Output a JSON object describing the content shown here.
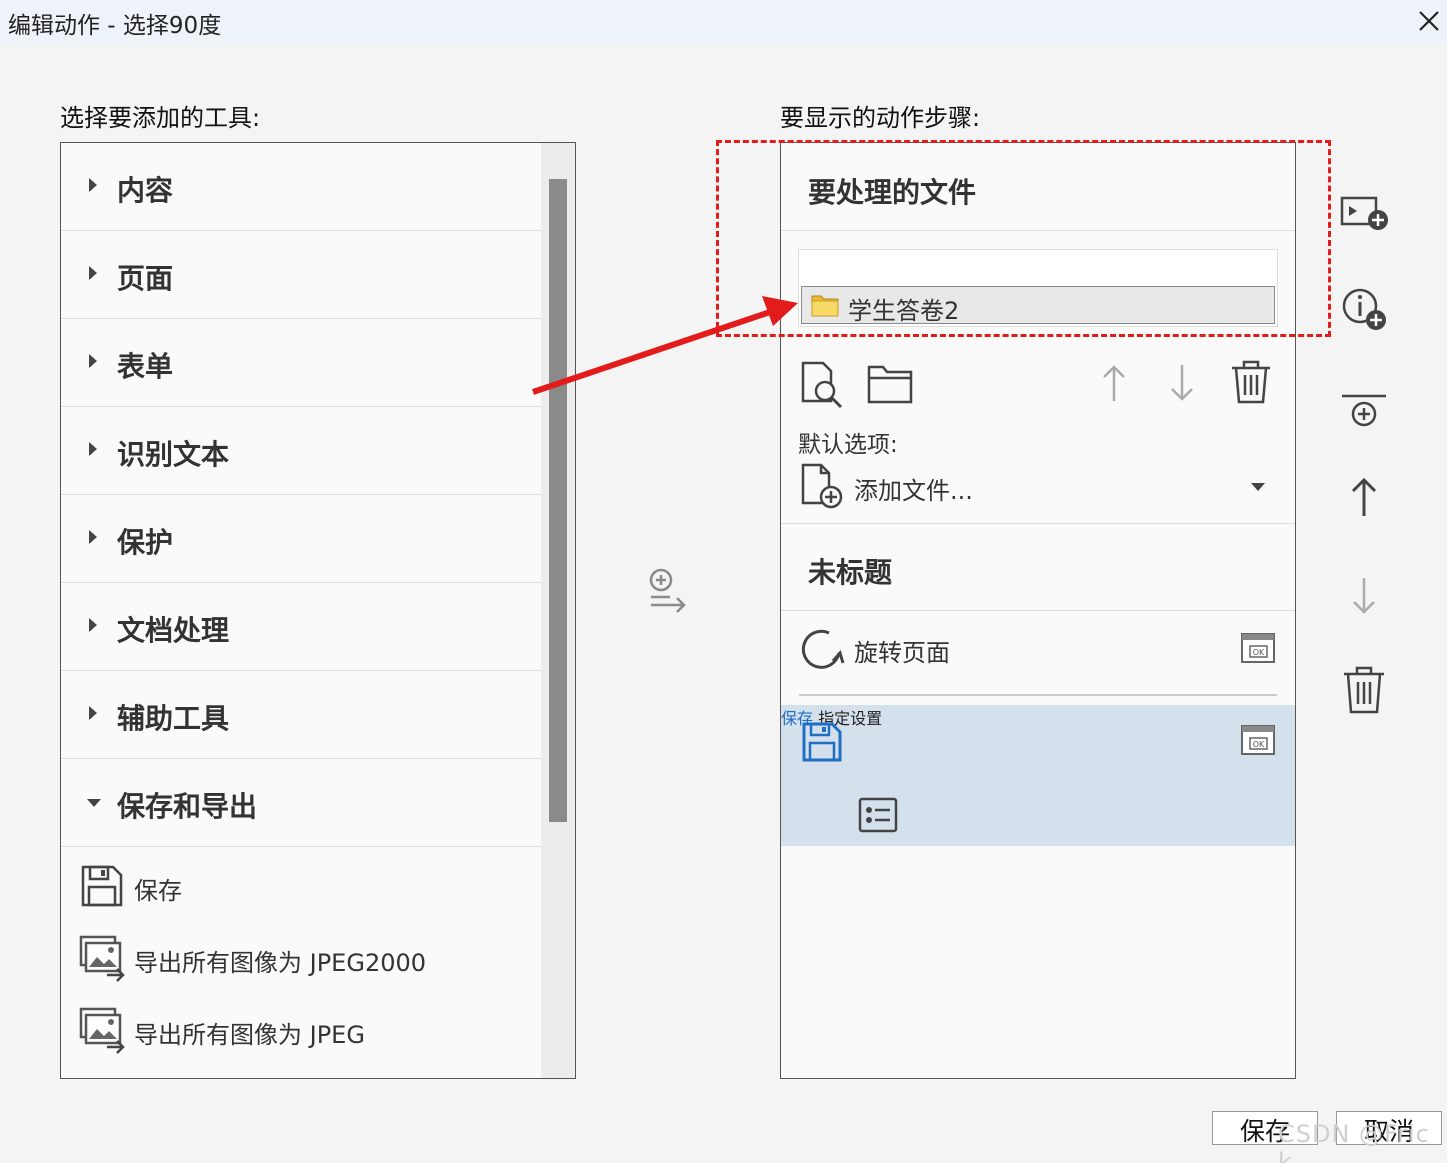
{
  "window": {
    "title": "编辑动作 - 选择90度"
  },
  "left": {
    "heading": "选择要添加的工具:",
    "categories": [
      {
        "label": "内容",
        "expanded": false
      },
      {
        "label": "页面",
        "expanded": false
      },
      {
        "label": "表单",
        "expanded": false
      },
      {
        "label": "识别文本",
        "expanded": false
      },
      {
        "label": "保护",
        "expanded": false
      },
      {
        "label": "文档处理",
        "expanded": false
      },
      {
        "label": "辅助工具",
        "expanded": false
      },
      {
        "label": "保存和导出",
        "expanded": true
      }
    ],
    "tools": [
      {
        "label": "保存",
        "icon": "save-icon"
      },
      {
        "label": "导出所有图像为 JPEG2000",
        "icon": "export-images-icon"
      },
      {
        "label": "导出所有图像为 JPEG",
        "icon": "export-images-icon"
      }
    ]
  },
  "right": {
    "heading": "要显示的动作步骤:",
    "files_section": {
      "title": "要处理的文件",
      "folder": "学生答卷2",
      "default_options_label": "默认选项:",
      "add_file_option": "添加文件..."
    },
    "untitled_section": {
      "title": "未标题"
    },
    "steps": [
      {
        "label": "旋转页面",
        "icon": "rotate-icon"
      },
      {
        "label": "保存",
        "icon": "save-icon",
        "selected": true
      },
      {
        "label": "指定设置",
        "icon": "settings-list-icon"
      }
    ]
  },
  "footer": {
    "save": "保存",
    "cancel": "取消"
  },
  "watermark": "CSDN @Fric k",
  "colors": {
    "accent": "#1f6fc4",
    "highlight": "#e21b1b",
    "selected_bg": "#d4e1ec"
  }
}
